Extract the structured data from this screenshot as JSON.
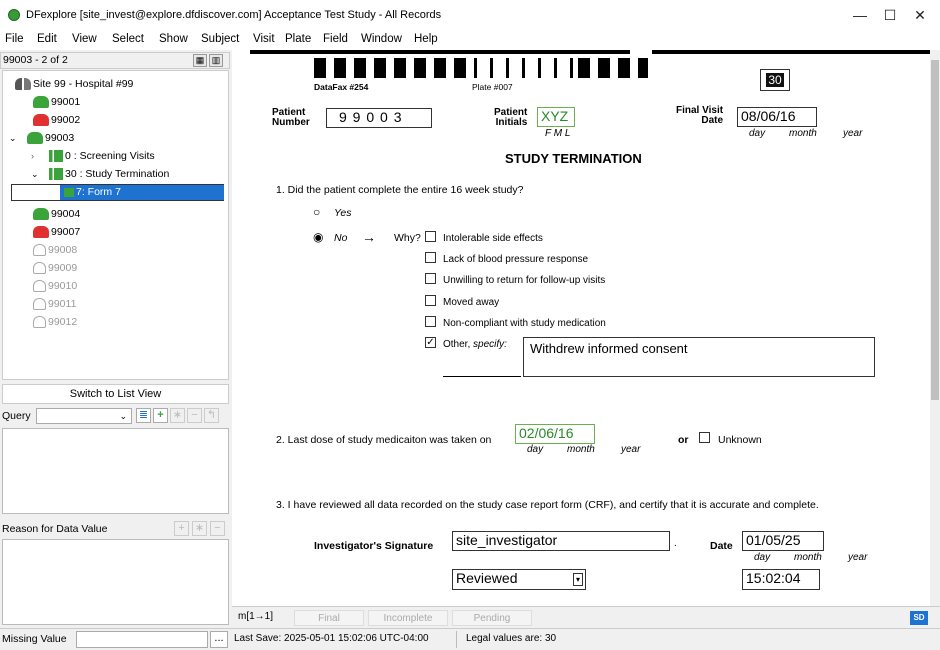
{
  "window": {
    "title": "DFexplore [site_invest@explore.dfdiscover.com] Acceptance Test Study - All Records",
    "minimize": "—",
    "maximize": "☐",
    "close": "✕"
  },
  "menu": [
    "File",
    "Edit",
    "View",
    "Select",
    "Show",
    "Subject",
    "Visit",
    "Plate",
    "Field",
    "Window",
    "Help"
  ],
  "left": {
    "record_header": "99003 - 2 of 2",
    "tree": {
      "site": "Site 99 - Hospital #99",
      "patients_active": [
        "99001",
        "99002",
        "99003"
      ],
      "visit_screening": "0 : Screening Visits",
      "visit_termination": "30 : Study Termination",
      "form": "7: Form 7",
      "patients_after": [
        "99004",
        "99007"
      ],
      "patients_grey": [
        "99008",
        "99009",
        "99010",
        "99011",
        "99012"
      ]
    },
    "switch_button": "Switch to List View",
    "query_label": "Query",
    "reason_label": "Reason for Data Value",
    "missing_label": "Missing Value",
    "missing_btn": "..."
  },
  "form": {
    "datafax_label": "DataFax #254",
    "plate_label": "Plate #007",
    "visit_number": "30",
    "patient_number_label_1": "Patient",
    "patient_number_label_2": "Number",
    "patient_number": "9 9 0 0 3",
    "patient_initials_label_1": "Patient",
    "patient_initials_label_2": "Initials",
    "patient_initials": "XYZ",
    "initials_hint": "F  M  L",
    "final_visit_label_1": "Final Visit",
    "final_visit_label_2": "Date",
    "final_visit_date": "08/06/16",
    "date_hint_day": "day",
    "date_hint_month": "month",
    "date_hint_year": "year",
    "section_title": "STUDY TERMINATION",
    "q1": "1.  Did the patient complete the entire 16 week study?",
    "yes": "Yes",
    "no": "No",
    "arrow": "→",
    "why": "Why?",
    "reasons": [
      "Intolerable side effects",
      "Lack of blood pressure response",
      "Unwilling to return for follow-up visits",
      "Moved away",
      "Non-compliant with study medication"
    ],
    "other_label": "Other,",
    "other_specify": "specify:",
    "other_value": "Withdrew informed consent",
    "q2": "2.  Last dose of study medicaiton was taken on",
    "last_dose_date": "02/06/16",
    "or": "or",
    "unknown": "Unknown",
    "q3": "3.  I have reviewed all data recorded on the study case report form (CRF), and certify that it is accurate and complete.",
    "signature_label": "Investigator's Signature",
    "signature_value": "site_investigator",
    "sig_date_label": "Date",
    "sig_date": "01/05/25",
    "review_status": "Reviewed",
    "time_value": "15:02:04"
  },
  "statusbar": {
    "level": "m[1→1]",
    "final": "Final",
    "incomplete": "Incomplete",
    "pending": "Pending",
    "sd": "SD",
    "last_save": "Last Save: 2025-05-01 15:02:06 UTC-04:00",
    "legal": "Legal values are: 30"
  },
  "colors": {
    "green": "#3aa33a",
    "red": "#e03030",
    "selected": "#1e73d0"
  }
}
